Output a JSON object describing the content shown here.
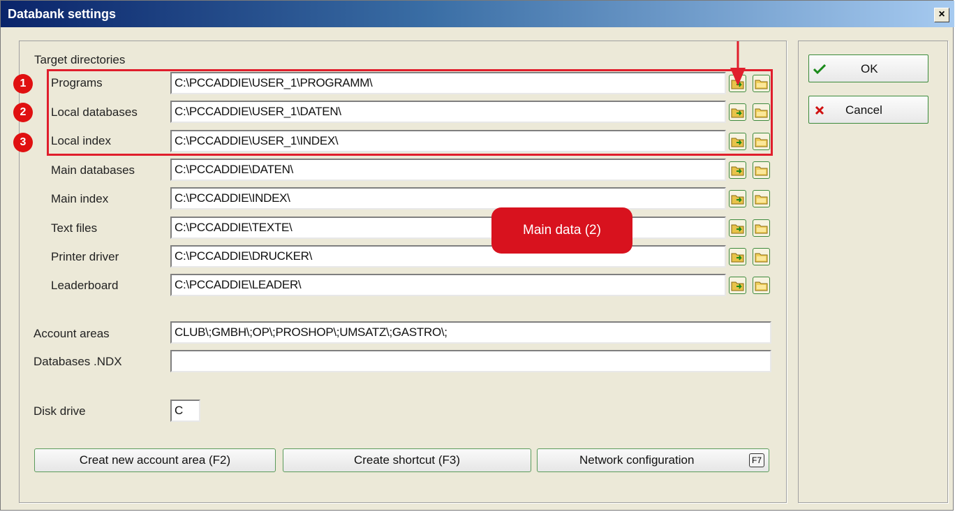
{
  "window": {
    "title": "Databank settings",
    "close_label": "×"
  },
  "group_label": "Target directories",
  "directories": [
    {
      "label": "Programs",
      "value": "C:\\PCCADDIE\\USER_1\\PROGRAMM\\"
    },
    {
      "label": "Local databases",
      "value": "C:\\PCCADDIE\\USER_1\\DATEN\\"
    },
    {
      "label": "Local index",
      "value": "C:\\PCCADDIE\\USER_1\\INDEX\\"
    },
    {
      "label": "Main databases",
      "value": "C:\\PCCADDIE\\DATEN\\"
    },
    {
      "label": "Main index",
      "value": "C:\\PCCADDIE\\INDEX\\"
    },
    {
      "label": "Text files",
      "value": "C:\\PCCADDIE\\TEXTE\\"
    },
    {
      "label": "Printer driver",
      "value": "C:\\PCCADDIE\\DRUCKER\\"
    },
    {
      "label": "Leaderboard",
      "value": "C:\\PCCADDIE\\LEADER\\"
    }
  ],
  "account_areas": {
    "label": "Account areas",
    "value": "CLUB\\;GMBH\\;OP\\;PROSHOP\\;UMSATZ\\;GASTRO\\;"
  },
  "databases_ndx": {
    "label": "Databases .NDX",
    "value": ""
  },
  "disk_drive": {
    "label": "Disk drive",
    "value": "C"
  },
  "buttons": {
    "create_account": "Creat new account area (F2)",
    "create_shortcut": "Create shortcut (F3)",
    "network": "Network configuration",
    "network_key": "F7"
  },
  "side_buttons": {
    "ok": "OK",
    "cancel": "Cancel"
  },
  "annotations": {
    "badges": [
      "1",
      "2",
      "3"
    ],
    "callout": "Main data (2)"
  },
  "colors": {
    "highlight": "#e01e2c",
    "title_start": "#0a246a",
    "accent_green": "#3d8a3d"
  }
}
